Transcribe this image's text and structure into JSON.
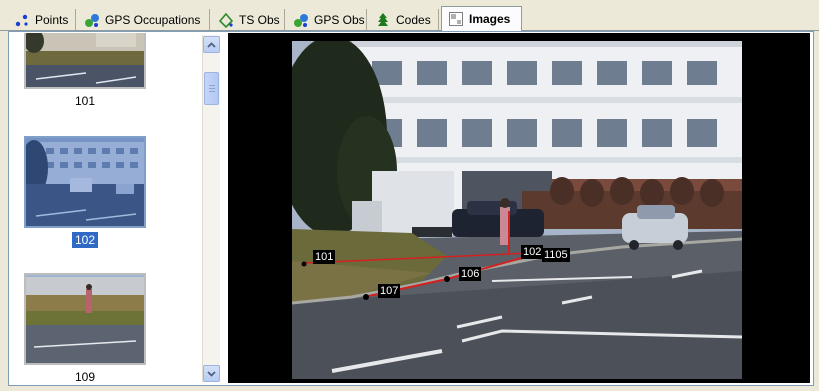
{
  "tabs": [
    {
      "label": "Points",
      "icon": "points-icon"
    },
    {
      "label": "GPS Occupations",
      "icon": "gps-occupations-icon"
    },
    {
      "label": "TS Obs",
      "icon": "ts-obs-icon"
    },
    {
      "label": "GPS Obs",
      "icon": "gps-obs-icon"
    },
    {
      "label": "Codes",
      "icon": "codes-icon"
    },
    {
      "label": "Images",
      "icon": "images-icon",
      "active": true
    }
  ],
  "thumbnails": [
    {
      "caption": "101",
      "selected": false
    },
    {
      "caption": "102",
      "selected": true
    },
    {
      "caption": "109",
      "selected": false
    }
  ],
  "viewer": {
    "point_labels": {
      "p101": "101",
      "p102": "102",
      "p1105": "1105",
      "p106": "106",
      "p107": "107"
    },
    "line_color": "#d42020"
  },
  "colors": {
    "selection": "#316ac5",
    "border": "#7f9db9"
  }
}
